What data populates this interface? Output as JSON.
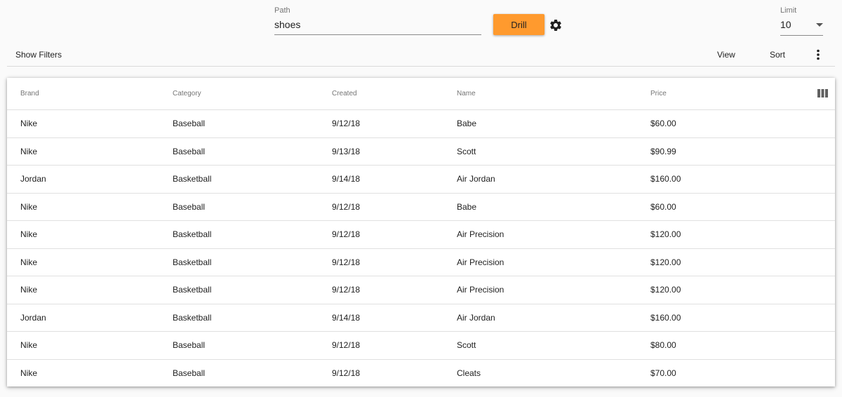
{
  "query": {
    "path_label": "Path",
    "path_value": "shoes",
    "drill_label": "Drill",
    "limit_label": "Limit",
    "limit_value": "10"
  },
  "toolbar": {
    "show_filters": "Show Filters",
    "view": "View",
    "sort": "Sort"
  },
  "table": {
    "headers": [
      "Brand",
      "Category",
      "Created",
      "Name",
      "Price"
    ],
    "rows": [
      [
        "Nike",
        "Baseball",
        "9/12/18",
        "Babe",
        "$60.00"
      ],
      [
        "Nike",
        "Baseball",
        "9/13/18",
        "Scott",
        "$90.99"
      ],
      [
        "Jordan",
        "Basketball",
        "9/14/18",
        "Air Jordan",
        "$160.00"
      ],
      [
        "Nike",
        "Baseball",
        "9/12/18",
        "Babe",
        "$60.00"
      ],
      [
        "Nike",
        "Basketball",
        "9/12/18",
        "Air Precision",
        "$120.00"
      ],
      [
        "Nike",
        "Basketball",
        "9/12/18",
        "Air Precision",
        "$120.00"
      ],
      [
        "Nike",
        "Basketball",
        "9/12/18",
        "Air Precision",
        "$120.00"
      ],
      [
        "Jordan",
        "Basketball",
        "9/14/18",
        "Air Jordan",
        "$160.00"
      ],
      [
        "Nike",
        "Baseball",
        "9/12/18",
        "Scott",
        "$80.00"
      ],
      [
        "Nike",
        "Baseball",
        "9/12/18",
        "Cleats",
        "$70.00"
      ]
    ]
  },
  "icons": {
    "settings": "gear-icon",
    "limit_dropdown": "caret-down-icon",
    "more": "more-vert-icon",
    "columns": "view-column-icon"
  },
  "colors": {
    "accent": "#ff9a2e",
    "background": "#fafafa",
    "divider": "#e0e0e0"
  }
}
